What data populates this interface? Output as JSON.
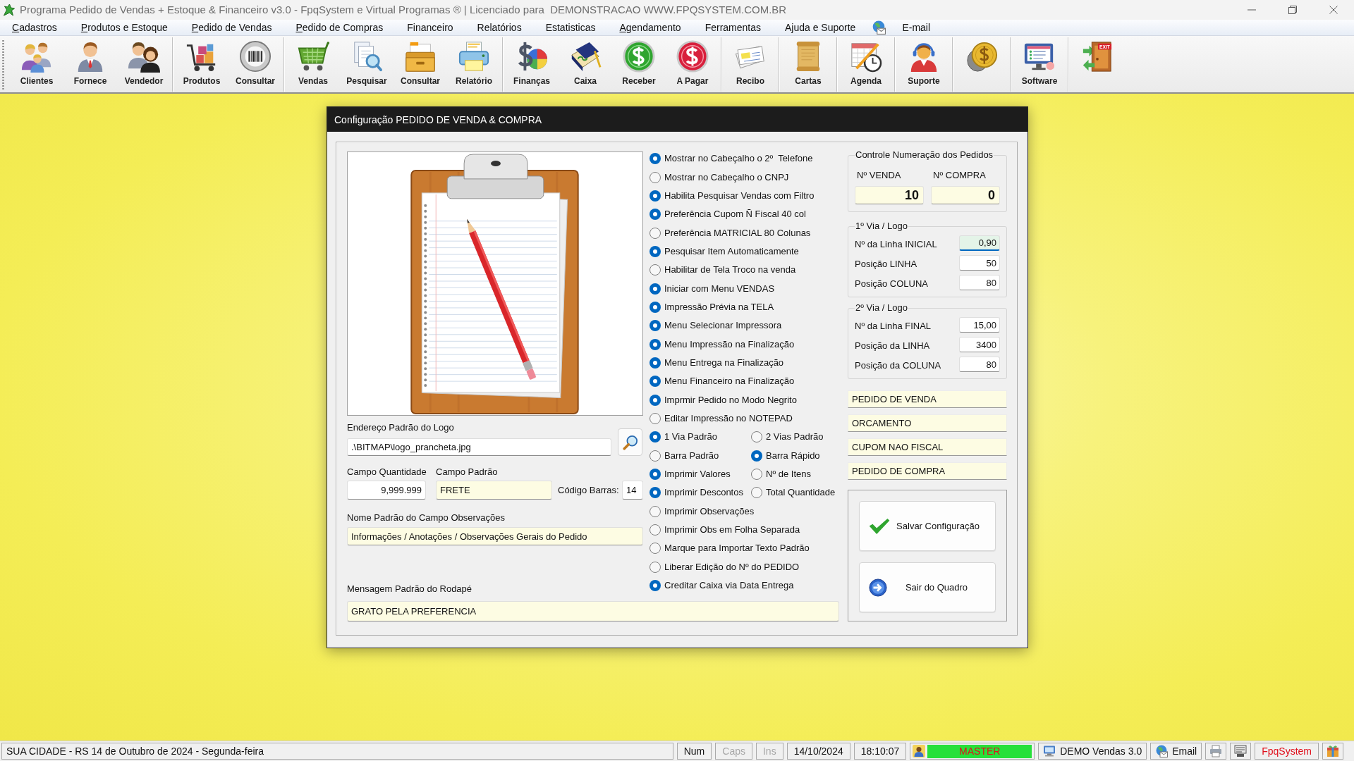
{
  "window": {
    "title": "Programa Pedido de Vendas + Estoque & Financeiro v3.0 - FpqSystem e Virtual Programas ® | Licenciado para  DEMONSTRACAO WWW.FPQSYSTEM.COM.BR"
  },
  "menu": [
    {
      "kind": "text",
      "label": "Cadastros",
      "mnemonic": true
    },
    {
      "kind": "text",
      "label": "Produtos e Estoque",
      "mnemonic": true
    },
    {
      "kind": "text",
      "label": "Pedido de Vendas",
      "mnemonic": true
    },
    {
      "kind": "text",
      "label": "Pedido de Compras",
      "mnemonic": true
    },
    {
      "kind": "text",
      "label": "Financeiro",
      "mnemonic": false
    },
    {
      "kind": "text",
      "label": "Relatórios",
      "mnemonic": false
    },
    {
      "kind": "text",
      "label": "Estatisticas",
      "mnemonic": false
    },
    {
      "kind": "text",
      "label": "Agendamento",
      "mnemonic": true
    },
    {
      "kind": "text",
      "label": "Ferramentas",
      "mnemonic": false
    },
    {
      "kind": "text",
      "label": "Ajuda e Suporte",
      "mnemonic": false
    },
    {
      "kind": "icon"
    },
    {
      "kind": "text",
      "label": "E-mail",
      "mnemonic": false
    }
  ],
  "toolbar": [
    {
      "kind": "labeled",
      "label": "Clientes"
    },
    {
      "kind": "labeled",
      "label": "Fornece"
    },
    {
      "kind": "labeled",
      "label": "Vendedor"
    },
    {
      "kind": "separator"
    },
    {
      "kind": "labeled",
      "label": "Produtos"
    },
    {
      "kind": "labeled",
      "label": "Consultar"
    },
    {
      "kind": "separator"
    },
    {
      "kind": "labeled",
      "label": "Vendas"
    },
    {
      "kind": "labeled",
      "label": "Pesquisar"
    },
    {
      "kind": "labeled",
      "label": "Consultar"
    },
    {
      "kind": "labeled",
      "label": "Relatório"
    },
    {
      "kind": "separator"
    },
    {
      "kind": "labeled",
      "label": "Finanças"
    },
    {
      "kind": "labeled",
      "label": "Caixa"
    },
    {
      "kind": "labeled",
      "label": "Receber"
    },
    {
      "kind": "labeled",
      "label": "A Pagar"
    },
    {
      "kind": "separator"
    },
    {
      "kind": "labeled",
      "label": "Recibo"
    },
    {
      "kind": "separator"
    },
    {
      "kind": "labeled",
      "label": "Cartas"
    },
    {
      "kind": "separator"
    },
    {
      "kind": "labeled",
      "label": "Agenda"
    },
    {
      "kind": "separator"
    },
    {
      "kind": "labeled",
      "label": "Suporte"
    },
    {
      "kind": "separator"
    },
    {
      "kind": "icon"
    },
    {
      "kind": "separator"
    },
    {
      "kind": "labeled",
      "label": "Software"
    },
    {
      "kind": "separator"
    },
    {
      "kind": "icon",
      "sign": "EXIT"
    }
  ],
  "dialog": {
    "title": "Configuração PEDIDO DE VENDA & COMPRA",
    "logo_path": {
      "label": "Endereço Padrão do Logo",
      "value": ".\\BITMAP\\logo_prancheta.jpg"
    },
    "quantity": {
      "label": "Campo Quantidade",
      "value": "9,999.999"
    },
    "default_field": {
      "label": "Campo Padrão",
      "value": "FRETE"
    },
    "barcode": {
      "label": "Código Barras:",
      "value": "14"
    },
    "notes_name": {
      "label": "Nome Padrão do Campo Observações",
      "value": "Informações / Anotações / Observações Gerais do Pedido"
    },
    "footer_message": {
      "label": "Mensagem Padrão do Rodapé",
      "value": "GRATO PELA PREFERENCIA"
    },
    "options": [
      [
        {
          "label": "Mostrar no Cabeçalho o 2º  Telefone",
          "selected": true
        }
      ],
      [
        {
          "label": "Mostrar no Cabeçalho o CNPJ",
          "selected": false
        }
      ],
      [
        {
          "label": "Habilita Pesquisar Vendas com Filtro",
          "selected": true
        }
      ],
      [
        {
          "label": "Preferência Cupom Ñ Fiscal 40 col",
          "selected": true
        }
      ],
      [
        {
          "label": "Preferência MATRICIAL 80 Colunas",
          "selected": false
        }
      ],
      [
        {
          "label": "Pesquisar Item Automaticamente",
          "selected": true
        }
      ],
      [
        {
          "label": "Habilitar de Tela Troco na venda",
          "selected": false
        }
      ],
      [
        {
          "label": "Iniciar com Menu VENDAS",
          "selected": true
        }
      ],
      [
        {
          "label": "Impressão Prévia na TELA",
          "selected": true
        }
      ],
      [
        {
          "label": "Menu Selecionar Impressora",
          "selected": true
        }
      ],
      [
        {
          "label": "Menu Impressão na Finalização",
          "selected": true
        }
      ],
      [
        {
          "label": "Menu Entrega na Finalização",
          "selected": true
        }
      ],
      [
        {
          "label": "Menu Financeiro na Finalização",
          "selected": true
        }
      ],
      [
        {
          "label": "Imprmir Pedido no Modo Negrito",
          "selected": true
        }
      ],
      [
        {
          "label": "Editar Impressão no NOTEPAD",
          "selected": false
        }
      ],
      [
        {
          "label": "1 Via Padrão",
          "selected": true
        },
        {
          "label": "2 Vias Padrão",
          "selected": false
        }
      ],
      [
        {
          "label": "Barra Padrão",
          "selected": false
        },
        {
          "label": "Barra Rápido",
          "selected": true
        }
      ],
      [
        {
          "label": "Imprimir Valores",
          "selected": true
        },
        {
          "label": "Nº de Itens",
          "selected": false
        }
      ],
      [
        {
          "label": "Imprimir Descontos",
          "selected": true
        },
        {
          "label": "Total Quantidade",
          "selected": false
        }
      ],
      [
        {
          "label": "Imprimir Observações",
          "selected": false
        }
      ],
      [
        {
          "label": "Imprimir Obs em Folha Separada",
          "selected": false
        }
      ],
      [
        {
          "label": "Marque para Importar Texto Padrão",
          "selected": false
        }
      ],
      [
        {
          "label": "Liberar Edição do Nº do PEDIDO",
          "selected": false
        }
      ],
      [
        {
          "label": "Creditar Caixa via Data Entrega",
          "selected": true
        }
      ]
    ],
    "numbering": {
      "title": "Controle Numeração dos Pedidos",
      "fields": [
        {
          "label": "Nº VENDA",
          "value": "10"
        },
        {
          "label": "Nº COMPRA",
          "value": "0"
        }
      ]
    },
    "position_groups": [
      {
        "title": "1º Via / Logo",
        "fields": [
          {
            "label": "Nº da Linha INICIAL",
            "value": "0,90",
            "focused": true
          },
          {
            "label": "Posição LINHA",
            "value": "50",
            "focused": false
          },
          {
            "label": "Posição COLUNA",
            "value": "80",
            "focused": false
          }
        ]
      },
      {
        "title": "2º Via / Logo",
        "fields": [
          {
            "label": "Nº da Linha FINAL",
            "value": "15,00",
            "focused": false
          },
          {
            "label": "Posição da LINHA",
            "value": "3400",
            "focused": false
          },
          {
            "label": "Posição da COLUNA",
            "value": "80",
            "focused": false
          }
        ]
      }
    ],
    "document_titles": [
      "PEDIDO DE VENDA",
      "ORCAMENTO",
      "CUPOM NAO FISCAL",
      "PEDIDO DE COMPRA"
    ],
    "buttons": [
      "Salvar Configuração",
      "Sair do Quadro"
    ]
  },
  "status_bar": [
    {
      "kind": "info",
      "text": "SUA CIDADE - RS 14 de Outubro de 2024 - Segunda-feira"
    },
    {
      "kind": "key",
      "text": "Num",
      "on": true
    },
    {
      "kind": "key",
      "text": "Caps",
      "on": false
    },
    {
      "kind": "key",
      "text": "Ins",
      "on": false
    },
    {
      "kind": "text",
      "text": "14/10/2024"
    },
    {
      "kind": "text",
      "text": "18:10:07"
    },
    {
      "kind": "user",
      "text": "MASTER"
    },
    {
      "kind": "icon_text",
      "text": "DEMO Vendas 3.0"
    },
    {
      "kind": "icon_text",
      "text": "Email"
    },
    {
      "kind": "icon"
    },
    {
      "kind": "icon"
    },
    {
      "kind": "brand",
      "text": "FpqSystem"
    },
    {
      "kind": "icon"
    }
  ]
}
